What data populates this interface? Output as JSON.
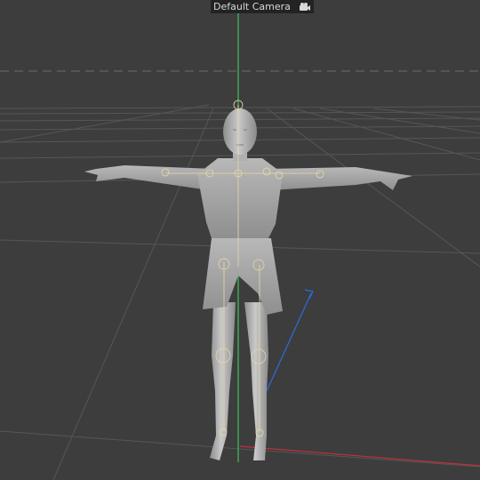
{
  "viewport": {
    "camera_label": "Default Camera",
    "camera_icon": "camera-icon",
    "colors": {
      "background": "#3d3d3d",
      "grid": "#585858",
      "y_axis": "#3fc25a",
      "z_axis": "#2d6be0",
      "x_axis": "#c0303a",
      "model": "#bdbdbd",
      "rig": "#e8d9a6"
    }
  }
}
